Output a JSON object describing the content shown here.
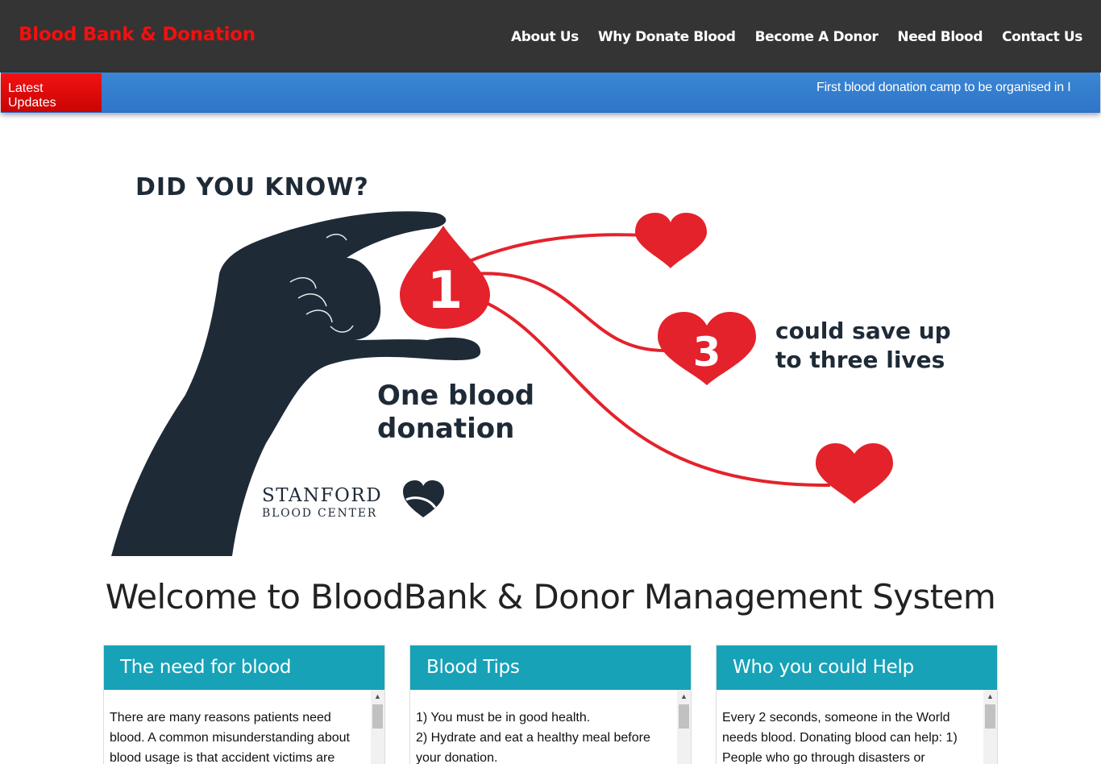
{
  "brand": "Blood Bank & Donation",
  "nav": [
    "About Us",
    "Why Donate Blood",
    "Become A Donor",
    "Need Blood",
    "Contact Us"
  ],
  "ticker": {
    "label": "Latest Updates",
    "text": "First blood donation camp to be organised in I"
  },
  "hero": {
    "headline": "DID YOU KNOW?",
    "drop_number": "1",
    "heart_number": "3",
    "line1": "One blood",
    "line2": "donation",
    "save_line1": "could save up",
    "save_line2": "to three lives",
    "logo_name": "STANFORD",
    "logo_sub": "BLOOD CENTER",
    "colors": {
      "red": "#e4222b",
      "navy": "#1f2a37"
    }
  },
  "welcome": "Welcome to BloodBank & Donor Management System",
  "cards": [
    {
      "title": "The need for blood",
      "text": "There are many reasons patients need blood. A common misunderstanding about blood usage is that accident victims are"
    },
    {
      "title": "Blood Tips",
      "lines": [
        "1) You must be in good health.",
        "2) Hydrate and eat a healthy meal before your donation."
      ]
    },
    {
      "title": "Who you could Help",
      "text": "Every 2 seconds, someone in the World needs blood. Donating blood can help: 1) People who go through disasters or"
    }
  ]
}
